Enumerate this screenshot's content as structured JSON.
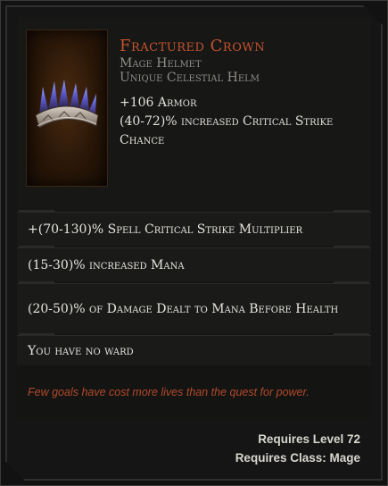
{
  "item": {
    "name": "Fractured Crown",
    "type": "Mage Helmet",
    "base": "Unique Celestial Helm",
    "implicits": [
      "+106 Armor",
      "(40-72)% increased Critical Strike Chance"
    ]
  },
  "affixes": [
    "+(70-130)% Spell Critical Strike Multiplier",
    "(15-30)% increased Mana",
    "(20-50)% of Damage Dealt to Mana Before Health",
    "You have no ward"
  ],
  "lore": "Few goals have cost more lives than the quest for power.",
  "requirements": {
    "level": "Requires Level 72",
    "class": "Requires Class: Mage"
  },
  "colors": {
    "name": "#c5532f",
    "lore": "#b24a2b",
    "text": "#e6e4de",
    "muted": "#8f8d88"
  },
  "icons": {
    "item_image": "crown-icon"
  }
}
